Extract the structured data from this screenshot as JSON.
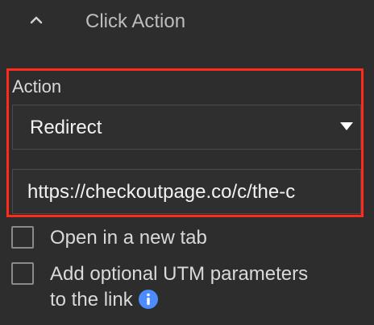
{
  "section": {
    "title": "Click Action",
    "chevron_icon": "chevron-up-icon"
  },
  "action": {
    "label": "Action",
    "selected": "Redirect",
    "caret_icon": "caret-down-icon"
  },
  "url": {
    "value": "https://checkoutpage.co/c/the-c"
  },
  "options": {
    "new_tab_label": "Open in a new tab",
    "utm_label_line1": "Add optional UTM parameters",
    "utm_label_line2": "to the link",
    "info_icon": "info-icon"
  },
  "colors": {
    "background": "#2d2d2d",
    "highlight": "#ff2a1a",
    "info": "#4d8cff"
  }
}
